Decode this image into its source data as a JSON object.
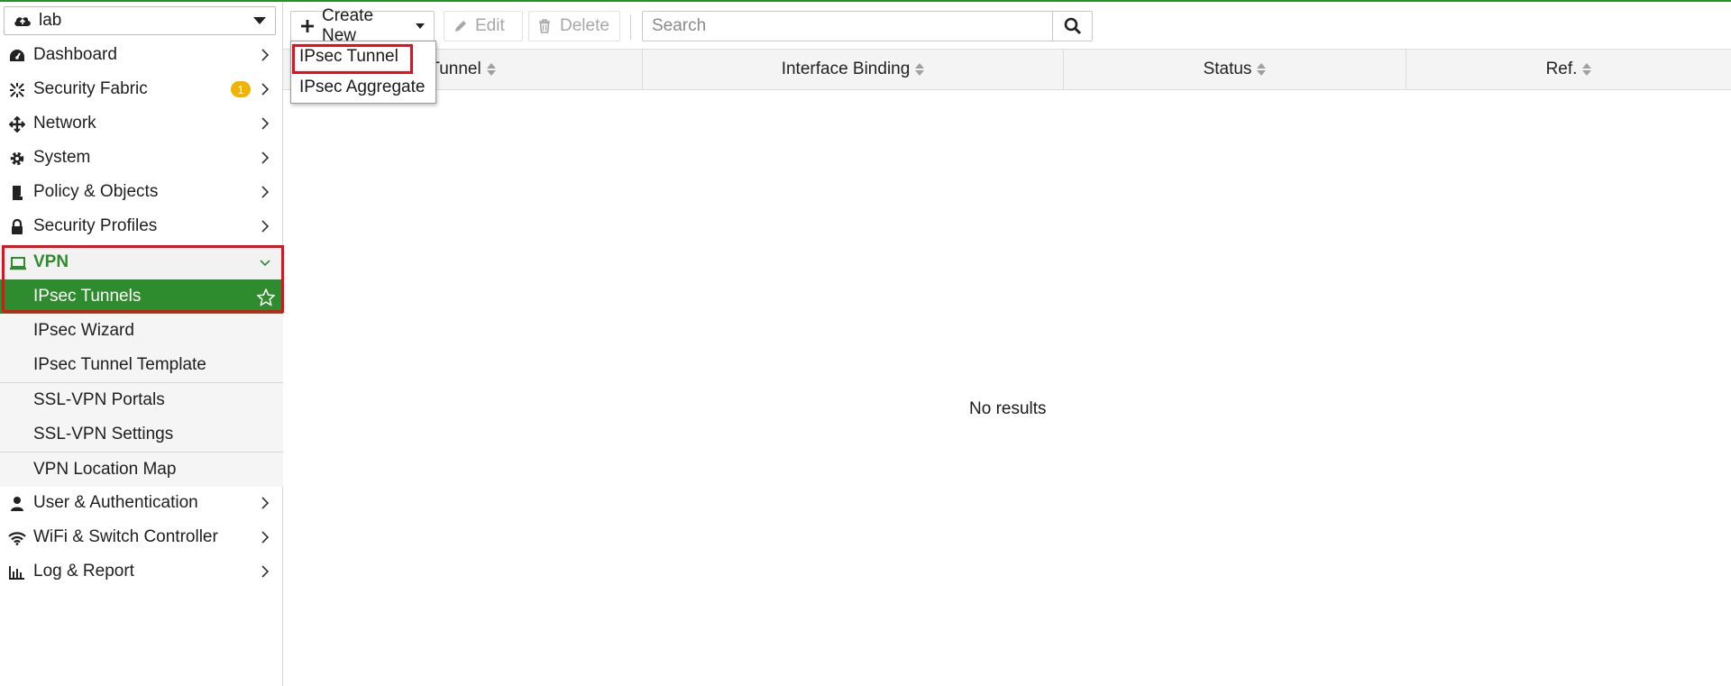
{
  "colors": {
    "accent": "#2e8b2e",
    "highlight": "#e0121c",
    "badge": "#f0b400"
  },
  "vdom": {
    "label": "lab",
    "icon": "cloud-icon"
  },
  "sidebar": {
    "items": [
      {
        "label": "Dashboard",
        "icon": "dashboard-icon"
      },
      {
        "label": "Security Fabric",
        "icon": "fabric-icon",
        "badge": "1"
      },
      {
        "label": "Network",
        "icon": "network-icon"
      },
      {
        "label": "System",
        "icon": "gear-icon"
      },
      {
        "label": "Policy & Objects",
        "icon": "policy-icon"
      },
      {
        "label": "Security Profiles",
        "icon": "lock-icon"
      }
    ],
    "vpn": {
      "label": "VPN",
      "icon": "laptop-icon",
      "sub_items": [
        {
          "label": "IPsec Tunnels",
          "active": true
        },
        {
          "label": "IPsec Wizard"
        },
        {
          "label": "IPsec Tunnel Template"
        },
        {
          "label": "SSL-VPN Portals"
        },
        {
          "label": "SSL-VPN Settings"
        },
        {
          "label": "VPN Location Map"
        }
      ]
    },
    "bottom_items": [
      {
        "label": "User & Authentication",
        "icon": "user-icon"
      },
      {
        "label": "WiFi & Switch Controller",
        "icon": "wifi-icon"
      },
      {
        "label": "Log & Report",
        "icon": "chart-icon"
      }
    ]
  },
  "toolbar": {
    "create_new": "Create New",
    "edit": "Edit",
    "delete": "Delete",
    "search_placeholder": "Search"
  },
  "dropdown": {
    "items": [
      "IPsec Tunnel",
      "IPsec Aggregate"
    ]
  },
  "table": {
    "columns": [
      "Tunnel",
      "Interface Binding",
      "Status",
      "Ref."
    ],
    "empty_text": "No results"
  }
}
